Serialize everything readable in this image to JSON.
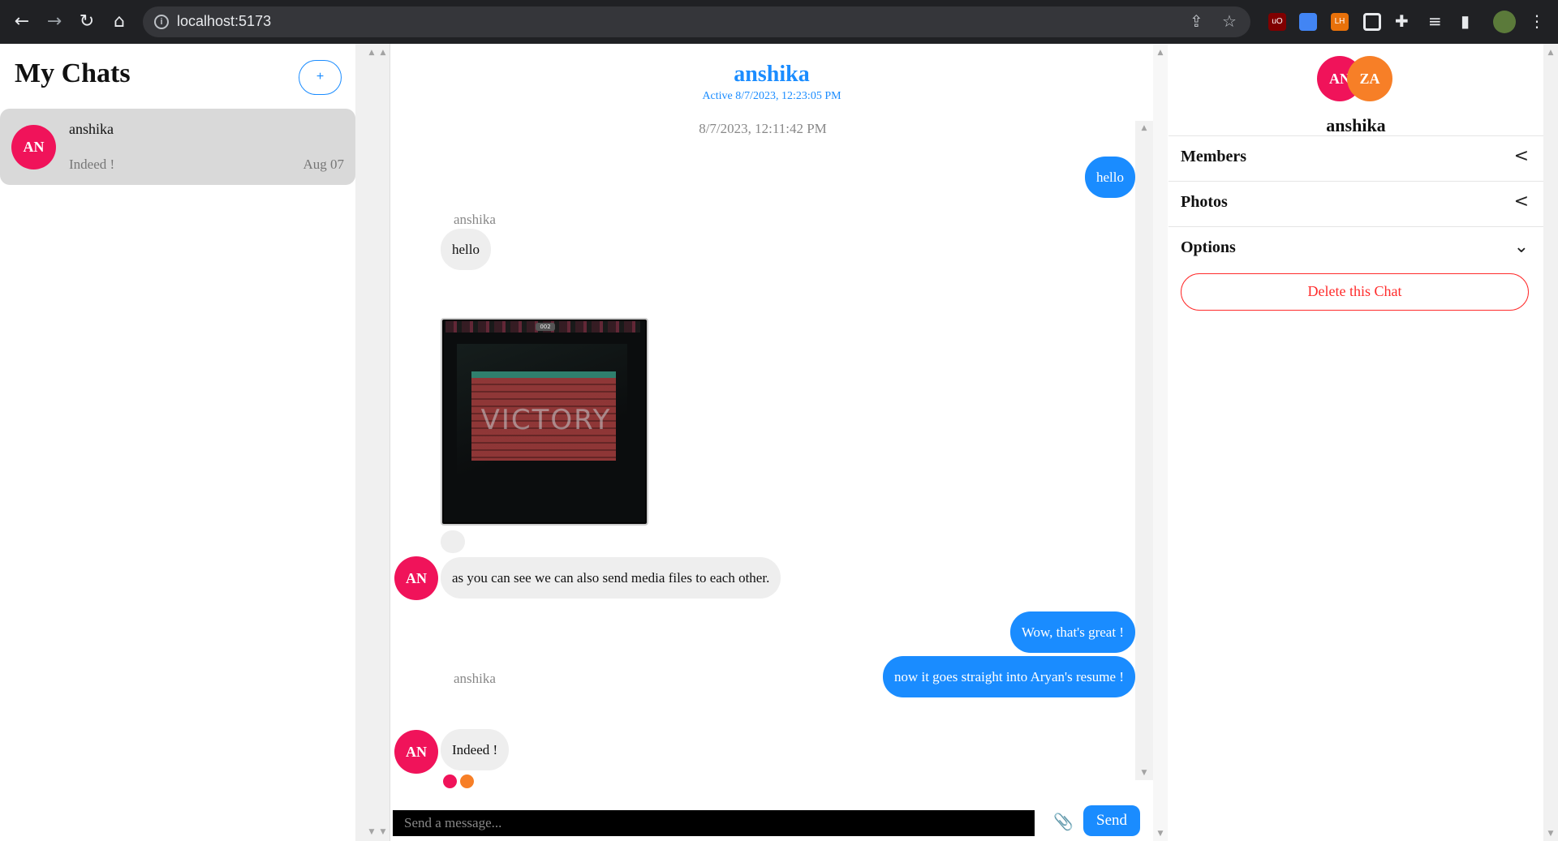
{
  "browser": {
    "url": "localhost:5173",
    "back_icon": "←",
    "forward_icon": "→",
    "reload_icon": "↻",
    "home_icon": "⌂",
    "info_icon": "i",
    "share_icon": "⇪",
    "star_icon": "☆",
    "extensions": [
      {
        "name": "ublock",
        "label": "uO",
        "color": "#800000"
      },
      {
        "name": "bookmark-ext",
        "label": "",
        "color": "#4285f4"
      },
      {
        "name": "lighthouse",
        "label": "LH",
        "color": "#e8710a"
      },
      {
        "name": "window-ext",
        "label": "",
        "color": "#e8eaed"
      }
    ],
    "puzzle_icon": "✚",
    "media_icon": "≡",
    "sidebar_icon": "▮",
    "menu_icon": "⋮"
  },
  "sidebar": {
    "title": "My Chats",
    "add_label": "+",
    "chats": [
      {
        "initials": "AN",
        "name": "anshika",
        "preview": "Indeed !",
        "date": "Aug 07"
      }
    ]
  },
  "chat": {
    "name": "anshika",
    "status": "Active 8/7/2023, 12:23:05 PM",
    "timestamp": "8/7/2023, 12:11:42 PM",
    "messages": [
      {
        "from": "me",
        "text": "hello"
      },
      {
        "from": "anshika",
        "sender": "anshika",
        "text": "hello"
      },
      {
        "from": "anshika",
        "type": "image",
        "caption": "VICTORY",
        "badge": "002"
      },
      {
        "from": "anshika",
        "initials": "AN",
        "text": "as you can see we can also send media files to each other."
      },
      {
        "from": "me",
        "text": "Wow, that's great !"
      },
      {
        "from": "me",
        "text": "now it goes straight into Aryan's resume !"
      },
      {
        "from": "anshika",
        "sender": "anshika",
        "initials": "AN",
        "text": "Indeed !"
      }
    ],
    "composer": {
      "placeholder": "Send a message...",
      "attach_icon": "📎",
      "send_label": "Send"
    }
  },
  "details": {
    "avatars": [
      "AN",
      "ZA"
    ],
    "name": "anshika",
    "sections": [
      {
        "label": "Members",
        "chevron": "<"
      },
      {
        "label": "Photos",
        "chevron": "<"
      },
      {
        "label": "Options",
        "chevron": "⌄"
      }
    ],
    "delete_label": "Delete this Chat"
  },
  "colors": {
    "accent": "#1a8cff",
    "avatar_an": "#f0135a",
    "avatar_za": "#f77f27",
    "danger": "#ff2b2b"
  }
}
